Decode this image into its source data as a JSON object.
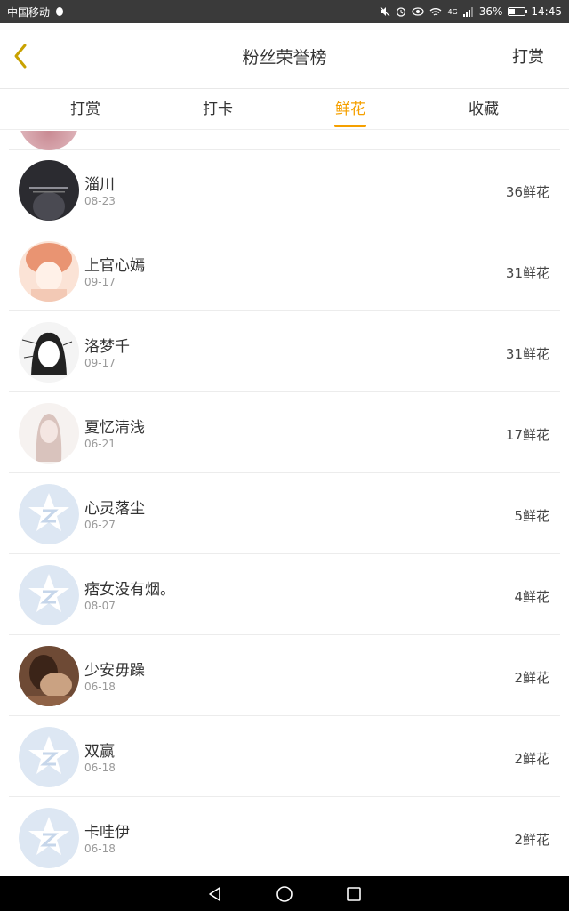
{
  "status_bar": {
    "carrier": "中国移动",
    "network": "4G",
    "battery": "36%",
    "battery_level": 0.36,
    "time": "14:45"
  },
  "header": {
    "back_icon": "chevron-left-icon",
    "title": "粉丝荣誉榜",
    "action_label": "打赏"
  },
  "tabs": [
    {
      "label": "打赏",
      "active": false
    },
    {
      "label": "打卡",
      "active": false
    },
    {
      "label": "鲜花",
      "active": true
    },
    {
      "label": "收藏",
      "active": false
    }
  ],
  "accent_color": "#f5a000",
  "list": [
    {
      "name": "淄川",
      "date": "08-23",
      "count": "36鲜花",
      "avatar": "photo-dark"
    },
    {
      "name": "上官心嫣",
      "date": "09-17",
      "count": "31鲜花",
      "avatar": "anime-orange"
    },
    {
      "name": "洛梦千",
      "date": "09-17",
      "count": "31鲜花",
      "avatar": "sketch-girl"
    },
    {
      "name": "夏忆清浅",
      "date": "06-21",
      "count": "17鲜花",
      "avatar": "pale-girl"
    },
    {
      "name": "心灵落尘",
      "date": "06-27",
      "count": "5鲜花",
      "avatar": "default-qzone"
    },
    {
      "name": "痞女没有烟。",
      "date": "08-07",
      "count": "4鲜花",
      "avatar": "default-qzone"
    },
    {
      "name": "少安毋躁",
      "date": "06-18",
      "count": "2鲜花",
      "avatar": "photo-warm"
    },
    {
      "name": "双赢",
      "date": "06-18",
      "count": "2鲜花",
      "avatar": "default-qzone"
    },
    {
      "name": "卡哇伊",
      "date": "06-18",
      "count": "2鲜花",
      "avatar": "default-qzone"
    }
  ],
  "nav_bar": [
    "back-triangle-icon",
    "home-circle-icon",
    "recents-square-icon"
  ]
}
